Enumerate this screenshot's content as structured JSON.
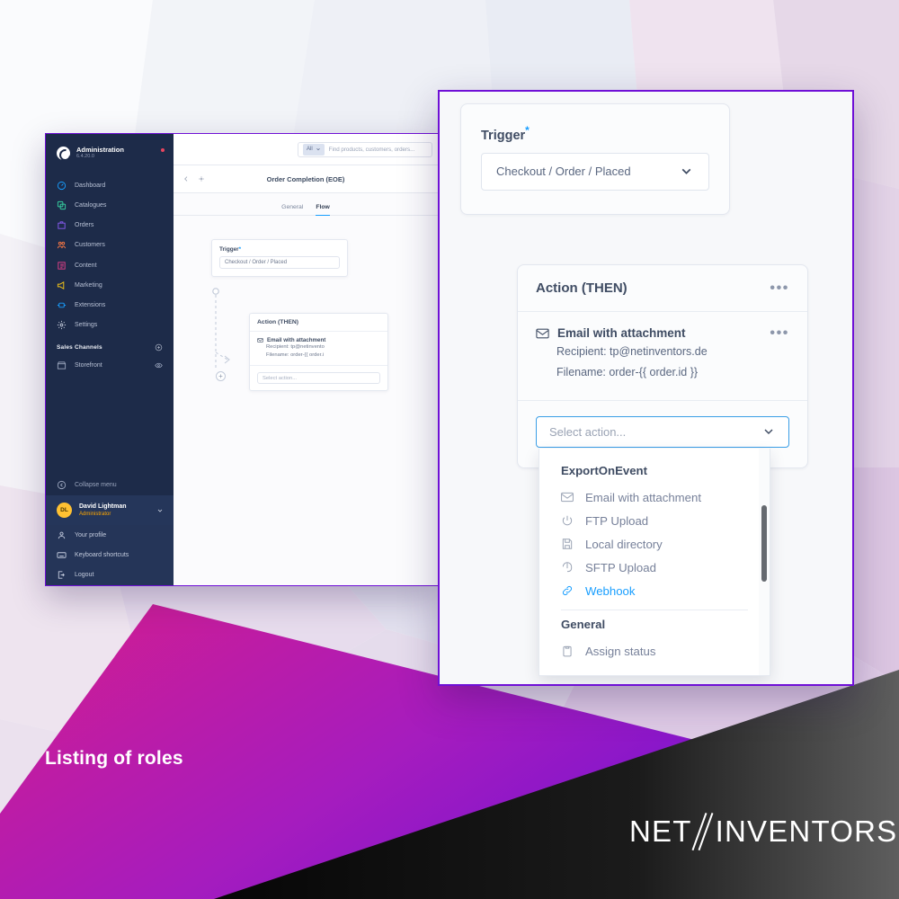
{
  "banner": {
    "title": "Listing of roles",
    "logo_text_left": "NET",
    "logo_text_right": "INVENTORS",
    "logo_icon": "double-slash-icon"
  },
  "admin_window": {
    "sidebar": {
      "brand": {
        "name": "Administration",
        "version": "6.4.20.0",
        "logo_icon": "shopware-logo-icon",
        "notification_icon": "notification-dot-icon"
      },
      "items": [
        {
          "label": "Dashboard",
          "icon": "dashboard-icon",
          "color": "#189eff"
        },
        {
          "label": "Catalogues",
          "icon": "catalogues-icon",
          "color": "#37d1a0"
        },
        {
          "label": "Orders",
          "icon": "orders-icon",
          "color": "#8b5cf6"
        },
        {
          "label": "Customers",
          "icon": "customers-icon",
          "color": "#ff7a45"
        },
        {
          "label": "Content",
          "icon": "content-icon",
          "color": "#e8408a"
        },
        {
          "label": "Marketing",
          "icon": "marketing-icon",
          "color": "#f5c518"
        },
        {
          "label": "Extensions",
          "icon": "extensions-icon",
          "color": "#189eff"
        },
        {
          "label": "Settings",
          "icon": "settings-gear-icon",
          "color": "#c4cbda"
        }
      ],
      "sales_channels": {
        "label": "Sales Channels",
        "add_icon": "plus-circle-icon"
      },
      "storefront": {
        "label": "Storefront",
        "icon": "storefront-icon",
        "eye_icon": "eye-icon"
      },
      "collapse": {
        "label": "Collapse menu",
        "icon": "collapse-icon"
      },
      "user": {
        "initials": "DL",
        "name": "David Lightman",
        "role": "Administrator",
        "chevron_icon": "chevron-down-icon"
      },
      "user_menu": [
        {
          "label": "Your profile",
          "icon": "user-icon"
        },
        {
          "label": "Keyboard shortcuts",
          "icon": "keyboard-icon"
        },
        {
          "label": "Logout",
          "icon": "logout-icon"
        }
      ]
    },
    "topbar": {
      "search_scope": "All",
      "search_scope_chevron": "chevron-down-icon",
      "search_placeholder": "Find products, customers, orders..."
    },
    "subbar": {
      "back_icon": "chevron-left-icon",
      "settings_icon": "gear-icon",
      "title": "Order Completion (EOE)"
    },
    "tabs": [
      {
        "label": "General",
        "active": false
      },
      {
        "label": "Flow",
        "active": true
      }
    ],
    "flow": {
      "trigger": {
        "label": "Trigger",
        "required_mark": "*",
        "value": "Checkout / Order / Placed",
        "chevron_icon": "chevron-down-icon"
      },
      "action": {
        "header": "Action (THEN)",
        "menu_icon": "ellipsis-icon",
        "item_title": "Email with attachment",
        "item_icon": "envelope-icon",
        "detail_recipient": "Recipient: tp@netinvento",
        "detail_filename": "Filename: order-{{ order.i",
        "select_placeholder": "Select action..."
      },
      "add_button_icon": "plus-circle-icon"
    }
  },
  "zoom_panel": {
    "trigger": {
      "label": "Trigger",
      "required_mark": "*",
      "value": "Checkout / Order / Placed",
      "chevron_icon": "chevron-down-icon"
    },
    "connector": {
      "node_icon": "circle-node-icon",
      "branch_arrow_icon": "branch-arrow-icon",
      "add_icon": "plus-circle-icon"
    },
    "action_card": {
      "header": "Action (THEN)",
      "header_menu_icon": "ellipsis-icon",
      "item_icon": "envelope-icon",
      "item_title": "Email with attachment",
      "item_menu_icon": "ellipsis-icon",
      "detail_recipient": "Recipient: tp@netinventors.de",
      "detail_filename": "Filename: order-{{ order.id }}",
      "select_placeholder": "Select action...",
      "select_chevron_icon": "chevron-down-icon",
      "select_border_color": "#3a9ee6"
    },
    "dropdown": {
      "scrollbar_icon": "scrollbar-thumb",
      "groups": [
        {
          "title": "ExportOnEvent",
          "items": [
            {
              "label": "Email with attachment",
              "icon": "envelope-icon",
              "highlighted": false
            },
            {
              "label": "FTP Upload",
              "icon": "ftp-upload-icon",
              "highlighted": false
            },
            {
              "label": "Local directory",
              "icon": "save-disk-icon",
              "highlighted": false
            },
            {
              "label": "SFTP Upload",
              "icon": "sftp-upload-icon",
              "highlighted": false
            },
            {
              "label": "Webhook",
              "icon": "link-icon",
              "highlighted": true
            }
          ]
        },
        {
          "title": "General",
          "items": [
            {
              "label": "Assign status",
              "icon": "clipboard-icon",
              "highlighted": false
            }
          ]
        }
      ]
    }
  },
  "colors": {
    "accent_purple": "#6f10d6",
    "accent_blue": "#189eff",
    "sidebar_bg": "#1d2b49",
    "band_magenta": "#d41d8d",
    "band_violet": "#7012d4",
    "avatar_yellow": "#ffc132",
    "role_orange": "#ffa800"
  }
}
